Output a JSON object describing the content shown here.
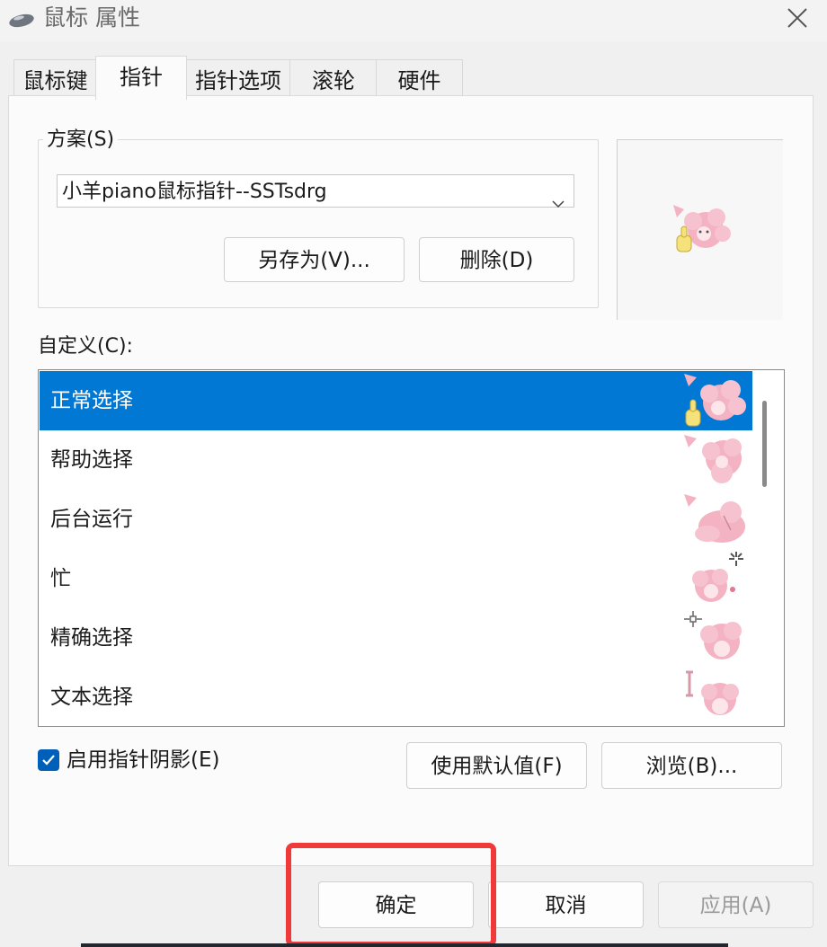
{
  "window": {
    "title": "鼠标 属性"
  },
  "tabs": [
    {
      "label": "鼠标键"
    },
    {
      "label": "指针"
    },
    {
      "label": "指针选项"
    },
    {
      "label": "滚轮"
    },
    {
      "label": "硬件"
    }
  ],
  "scheme": {
    "label": "方案(S)",
    "selected": "小羊piano鼠标指针--SSTsdrg",
    "save_as_label": "另存为(V)...",
    "delete_label": "删除(D)"
  },
  "customize": {
    "label": "自定义(C):",
    "items": [
      {
        "label": "正常选择",
        "selected": true
      },
      {
        "label": "帮助选择"
      },
      {
        "label": "后台运行"
      },
      {
        "label": "忙"
      },
      {
        "label": "精确选择"
      },
      {
        "label": "文本选择"
      }
    ]
  },
  "shadow": {
    "label": "启用指针阴影(E)",
    "checked": true
  },
  "use_default_label": "使用默认值(F)",
  "browse_label": "浏览(B)...",
  "footer": {
    "ok_label": "确定",
    "cancel_label": "取消",
    "apply_label": "应用(A)"
  },
  "colors": {
    "accent": "#0078d4",
    "highlight": "#f03a3a",
    "cursor_pink": "#f4b3c3",
    "cursor_yellow": "#f6e27a"
  }
}
